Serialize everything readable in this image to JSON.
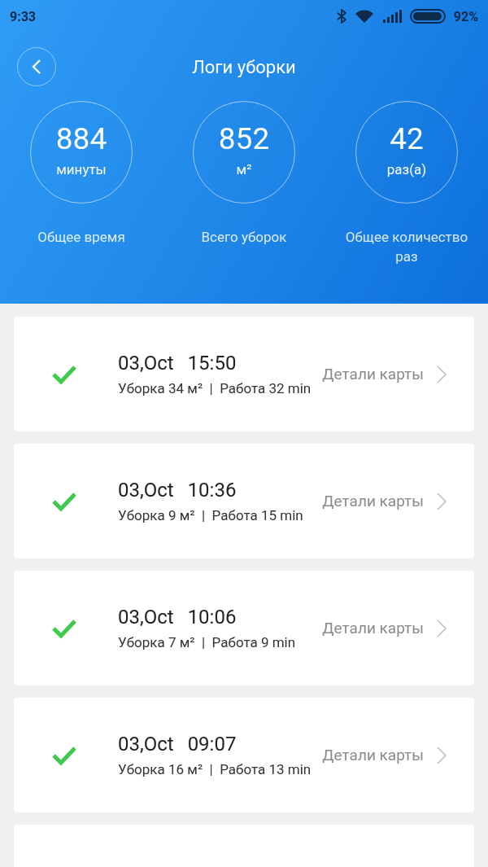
{
  "status_bar": {
    "time": "9:33",
    "battery": "92%"
  },
  "header": {
    "title": "Логи уборки"
  },
  "stats": [
    {
      "value": "884",
      "unit": "минуты",
      "label": "Общее время"
    },
    {
      "value": "852",
      "unit": "м²",
      "label": "Всего уборок"
    },
    {
      "value": "42",
      "unit": "раз(а)",
      "label": "Общее количество раз"
    }
  ],
  "logs": [
    {
      "date": "03,Oct",
      "time": "15:50",
      "summary": "Уборка 34 м²  |  Работа 32 min",
      "details": "Детали карты",
      "completed": true
    },
    {
      "date": "03,Oct",
      "time": "10:36",
      "summary": "Уборка 9 м²  |  Работа 15 min",
      "details": "Детали карты",
      "completed": true
    },
    {
      "date": "03,Oct",
      "time": "10:06",
      "summary": "Уборка 7 м²  |  Работа 9 min",
      "details": "Детали карты",
      "completed": true
    },
    {
      "date": "03,Oct",
      "time": "09:07",
      "summary": "Уборка 16 м²  |  Работа 13 min",
      "details": "Детали карты",
      "completed": true
    }
  ]
}
